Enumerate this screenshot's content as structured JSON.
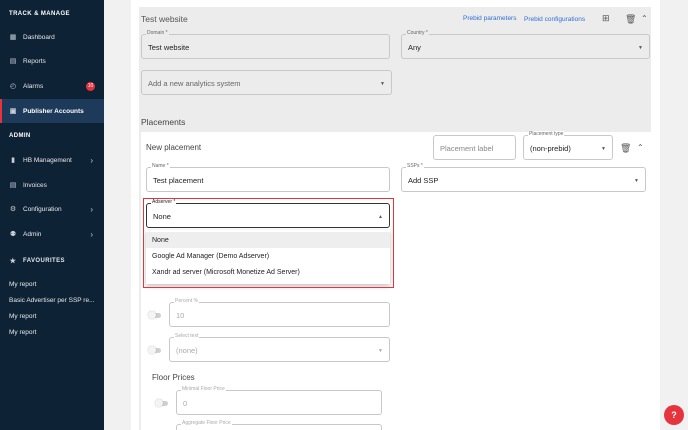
{
  "sidebar": {
    "section_track": "TRACK & MANAGE",
    "items_track": [
      {
        "label": "Dashboard",
        "icon": "dashboard-icon"
      },
      {
        "label": "Reports",
        "icon": "reports-icon"
      },
      {
        "label": "Alarms",
        "icon": "alarm-icon",
        "badge": "10"
      },
      {
        "label": "Publisher Accounts",
        "icon": "accounts-icon",
        "active": true
      }
    ],
    "section_admin": "ADMIN",
    "items_admin": [
      {
        "label": "HB Management",
        "icon": "hb-icon"
      },
      {
        "label": "Invoices",
        "icon": "invoice-icon"
      },
      {
        "label": "Configuration",
        "icon": "gear-icon"
      },
      {
        "label": "Admin",
        "icon": "admin-icon"
      }
    ],
    "section_fav": "FAVOURITES",
    "favourites": [
      "My report",
      "Basic Advertiser per SSP re...",
      "My report",
      "My report"
    ]
  },
  "site": {
    "title": "Test website",
    "prebid_params": "Prebid parameters",
    "prebid_configs": "Prebid configurations",
    "domain_label": "Domain *",
    "domain_value": "Test website",
    "country_label": "Country *",
    "country_value": "Any",
    "analytics_placeholder": "Add a new analytics system"
  },
  "placements": {
    "title": "Placements",
    "new_title": "New placement",
    "label_placeholder": "Placement label",
    "type_label": "Placement type",
    "type_value": "(non-prebid)",
    "name_label": "Name *",
    "name_value": "Test placement",
    "ssps_label": "SSPs *",
    "ssps_value": "Add SSP",
    "adserver_label": "Adserver *",
    "adserver_value": "None",
    "adserver_options": [
      "None",
      "Google Ad Manager (Demo Adserver)",
      "Xandr ad server (Microsoft Monetize Ad Server)"
    ],
    "pct_label": "Percent %",
    "pct_value": "10",
    "select_label": "Select text",
    "select_value": "(none)",
    "floor_title": "Floor Prices",
    "min_floor_label": "Minimal Floor Price",
    "min_floor_value": "0",
    "agg_floor_label": "Aggregate Floor Price"
  },
  "colors": {
    "sidebar_bg": "#0e2235",
    "accent": "#e6343f",
    "link": "#2f6fd6"
  }
}
